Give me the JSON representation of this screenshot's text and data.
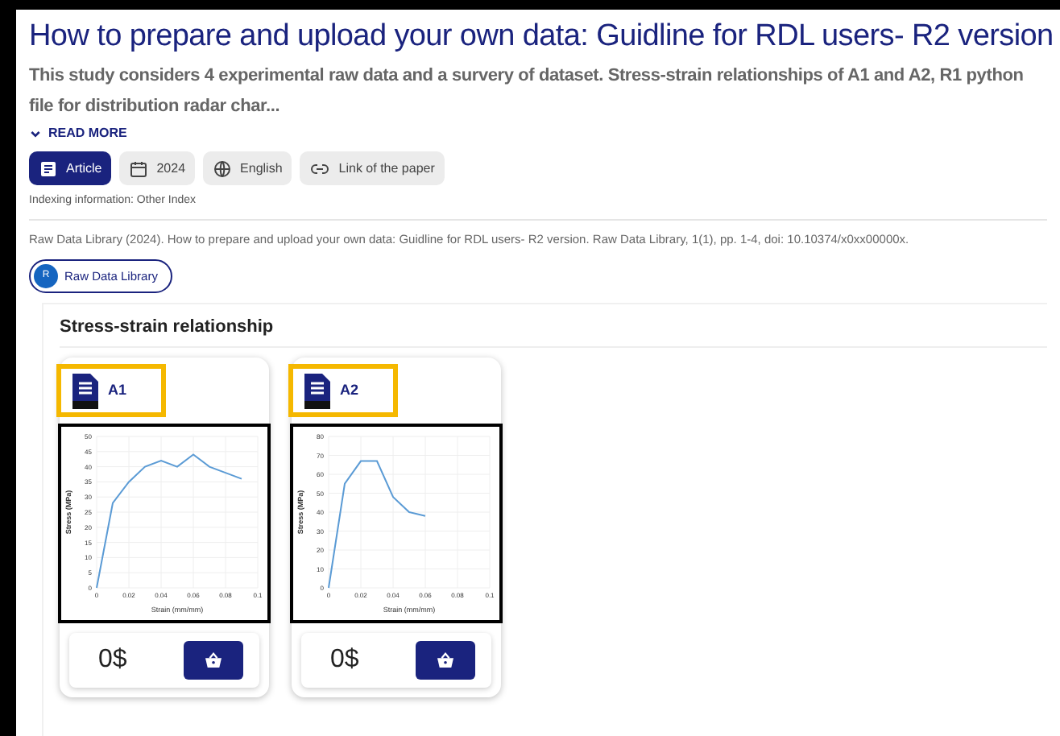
{
  "title": "How to prepare and upload your own data: Guidline for RDL users- R2 version",
  "description": "This study considers 4 experimental raw data and a survery of dataset. Stress-strain relationships of A1 and A2, R1 python file for distribution radar char...",
  "read_more": "READ MORE",
  "chips": [
    {
      "kind": "type",
      "label": "Article",
      "selected": true
    },
    {
      "kind": "year",
      "label": "2024",
      "selected": false
    },
    {
      "kind": "language",
      "label": "English",
      "selected": false
    },
    {
      "kind": "link",
      "label": "Link of the paper",
      "selected": false
    }
  ],
  "indexing": "Indexing information: Other Index",
  "citation": "Raw Data Library (2024). How to prepare and upload your own data: Guidline for RDL users- R2 version. Raw Data Library, 1(1), pp. 1-4, doi: 10.10374/x0xx00000x.",
  "publisher": {
    "initial": "R",
    "name": "Raw Data Library"
  },
  "section": {
    "title": "Stress-strain relationship",
    "files": [
      {
        "name": "A1",
        "price": "0$",
        "chart_data": {
          "type": "line",
          "xlabel": "Strain (mm/mm)",
          "ylabel": "Stress (MPa)",
          "xlim": [
            0,
            0.1
          ],
          "ylim": [
            0,
            50
          ],
          "xticks": [
            0,
            0.02,
            0.04,
            0.06,
            0.08,
            0.1
          ],
          "yticks": [
            0,
            5,
            10,
            15,
            20,
            25,
            30,
            35,
            40,
            45,
            50
          ],
          "x": [
            0,
            0.01,
            0.02,
            0.03,
            0.04,
            0.05,
            0.06,
            0.07,
            0.08,
            0.09
          ],
          "grid": true,
          "series": [
            {
              "color": "#5b9bd5",
              "values": [
                0,
                28,
                35,
                40,
                42,
                40,
                44,
                40,
                38,
                36
              ]
            }
          ]
        }
      },
      {
        "name": "A2",
        "price": "0$",
        "chart_data": {
          "type": "line",
          "xlabel": "Strain (mm/mm)",
          "ylabel": "Stress (MPa)",
          "xlim": [
            0,
            0.1
          ],
          "ylim": [
            0,
            80
          ],
          "xticks": [
            0,
            0.02,
            0.04,
            0.06,
            0.08,
            0.1
          ],
          "yticks": [
            0,
            10,
            20,
            30,
            40,
            50,
            60,
            70,
            80
          ],
          "x": [
            0,
            0.01,
            0.02,
            0.03,
            0.04,
            0.05,
            0.06
          ],
          "grid": true,
          "series": [
            {
              "color": "#5b9bd5",
              "values": [
                0,
                55,
                67,
                67,
                48,
                40,
                38
              ]
            }
          ]
        }
      }
    ]
  }
}
